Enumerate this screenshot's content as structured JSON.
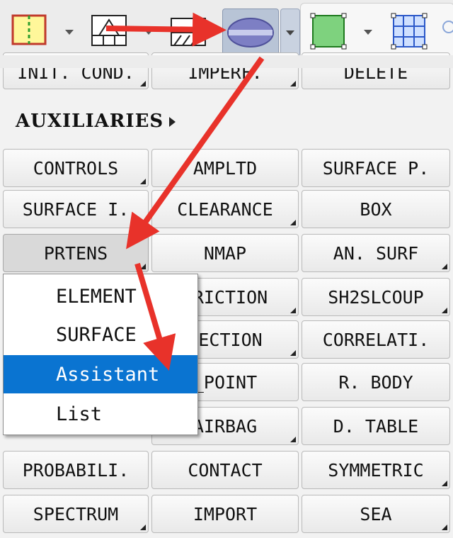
{
  "toolbar": {
    "tools": [
      {
        "name": "initial-condition-tool-icon"
      },
      {
        "name": "imperfection-tool-icon"
      },
      {
        "name": "hatched-solid-tool-icon"
      },
      {
        "name": "section-cut-tool-icon"
      },
      {
        "name": "green-shell-element-tool-icon"
      },
      {
        "name": "blue-mesh-grid-tool-icon"
      }
    ]
  },
  "top_row": [
    "INIT. COND.",
    "IMPERF.",
    "DELETE"
  ],
  "section_title": "AUXILIARIES",
  "grid": [
    [
      "CONTROLS",
      "AMPLTD",
      "SURFACE P."
    ],
    [
      "SURFACE I.",
      "CLEARANCE",
      "BOX"
    ],
    [
      "PRTENS",
      "NMAP",
      "AN. SURF"
    ],
    [
      "",
      "FRICTION",
      "SH2SLCOUP"
    ],
    [
      "",
      "SECTION",
      "CORRELATI."
    ],
    [
      "",
      "_POINT",
      "R. BODY"
    ],
    [
      "",
      "AIRBAG",
      "D. TABLE"
    ],
    [
      "PROBABILI.",
      "CONTACT",
      "SYMMETRIC"
    ],
    [
      "SPECTRUM",
      "IMPORT",
      "SEA"
    ]
  ],
  "context_menu": {
    "items": [
      "ELEMENT",
      "SURFACE",
      "Assistant",
      "List"
    ],
    "highlighted": "Assistant"
  },
  "colors": {
    "highlight": "#0a74d1",
    "arrow": "#e8322a"
  }
}
